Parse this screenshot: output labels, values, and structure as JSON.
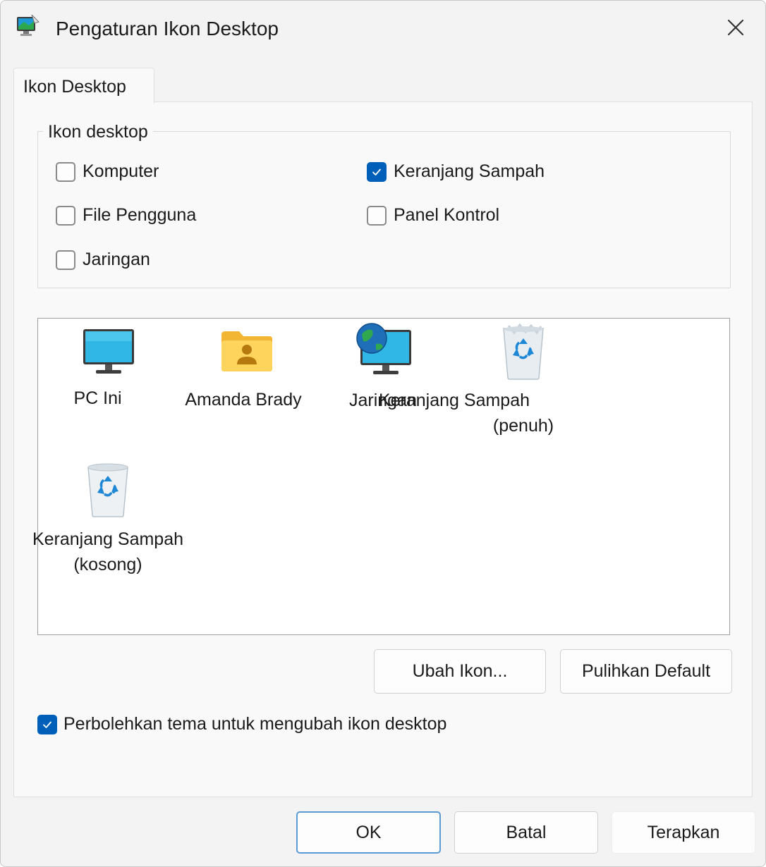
{
  "window": {
    "title": "Pengaturan Ikon Desktop",
    "icon": "display-properties-icon",
    "close_icon": "close-icon"
  },
  "tabs": [
    {
      "label": "Ikon Desktop",
      "selected": true
    }
  ],
  "group": {
    "legend": "Ikon desktop",
    "checkboxes": [
      {
        "label": "Komputer",
        "checked": false
      },
      {
        "label": "File Pengguna",
        "checked": false
      },
      {
        "label": "Jaringan",
        "checked": false
      },
      {
        "label": "Keranjang Sampah",
        "checked": true
      },
      {
        "label": "Panel Kontrol",
        "checked": false
      }
    ]
  },
  "preview": {
    "items": [
      {
        "label": "PC Ini",
        "icon": "monitor-icon",
        "selected": false
      },
      {
        "label": "Amanda Brady",
        "icon": "user-folder-icon",
        "selected": false
      },
      {
        "label": "Jaringan",
        "icon": "network-globe-icon",
        "selected": false
      },
      {
        "label_line1": "Keranjang Sampah",
        "label_line2": "(penuh)",
        "icon": "recycle-bin-full-icon",
        "selected": false
      },
      {
        "label_line1": "Keranjang Sampah",
        "label_line2": "(kosong)",
        "icon": "recycle-bin-empty-icon",
        "selected": false
      }
    ]
  },
  "buttons": {
    "change_icon": "Ubah Ikon...",
    "restore_default": "Pulihkan Default",
    "ok": "OK",
    "cancel": "Batal",
    "apply": "Terapkan"
  },
  "allow_themes": {
    "label": "Perbolehkan tema untuk mengubah ikon desktop",
    "checked": true
  },
  "colors": {
    "accent": "#005fb8",
    "window_bg": "#f3f3f3",
    "panel_bg": "#f9f9f9"
  }
}
